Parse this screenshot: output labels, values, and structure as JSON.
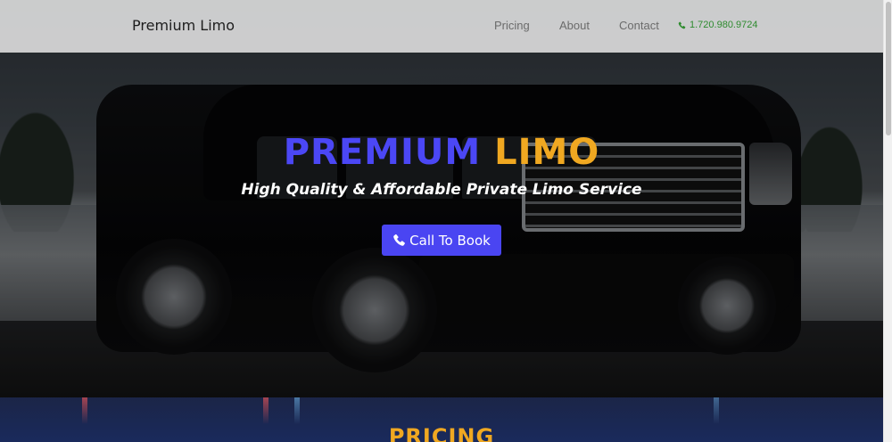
{
  "navbar": {
    "brand": "Premium Limo",
    "links": [
      "Pricing",
      "About",
      "Contact"
    ],
    "phone": "1.720.980.9724",
    "phone_icon": "phone-icon",
    "phone_color": "#2e8b2e"
  },
  "hero": {
    "title_part1": "PREMIUM",
    "title_part2": "LIMO",
    "subtitle": "High Quality & Affordable Private Limo Service",
    "cta_label": "Call To Book",
    "cta_icon": "phone-icon",
    "colors": {
      "title_part1": "#4b47f5",
      "title_part2": "#f0a821",
      "cta_bg": "#4a45f2"
    }
  },
  "pricing": {
    "heading": "PRICING"
  }
}
